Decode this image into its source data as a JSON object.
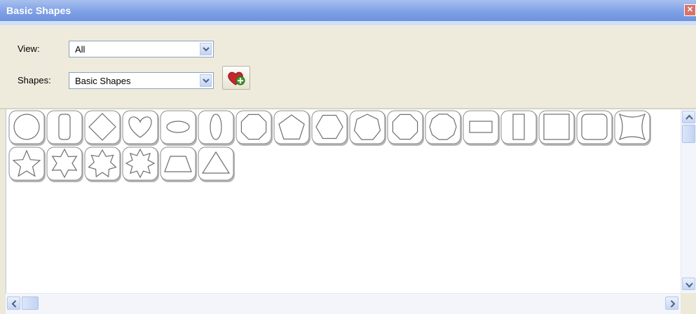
{
  "window": {
    "title": "Basic Shapes",
    "close_icon": "close-icon",
    "title_color": "#ffffff",
    "titlebar_color": "#7fa1e6"
  },
  "filters": {
    "view_label": "View:",
    "view_value": "All",
    "shapes_label": "Shapes:",
    "shapes_value": "Basic Shapes",
    "add_favorite_icon": "heart-plus-icon"
  },
  "shapes": [
    {
      "name": "circle"
    },
    {
      "name": "rounded-rectangle-vertical"
    },
    {
      "name": "diamond"
    },
    {
      "name": "heart"
    },
    {
      "name": "ellipse-horizontal"
    },
    {
      "name": "ellipse-vertical"
    },
    {
      "name": "octagon"
    },
    {
      "name": "pentagon"
    },
    {
      "name": "hexagon"
    },
    {
      "name": "heptagon"
    },
    {
      "name": "octagon-2"
    },
    {
      "name": "decagon"
    },
    {
      "name": "rectangle-horizontal"
    },
    {
      "name": "rectangle-vertical"
    },
    {
      "name": "square"
    },
    {
      "name": "rounded-square"
    },
    {
      "name": "concave-square"
    },
    {
      "name": "star-5"
    },
    {
      "name": "star-6"
    },
    {
      "name": "star-7"
    },
    {
      "name": "star-8"
    },
    {
      "name": "trapezoid"
    },
    {
      "name": "triangle"
    }
  ],
  "scrollbars": {
    "up_icon": "chevron-up-icon",
    "down_icon": "chevron-down-icon",
    "left_icon": "chevron-left-icon",
    "right_icon": "chevron-right-icon"
  }
}
